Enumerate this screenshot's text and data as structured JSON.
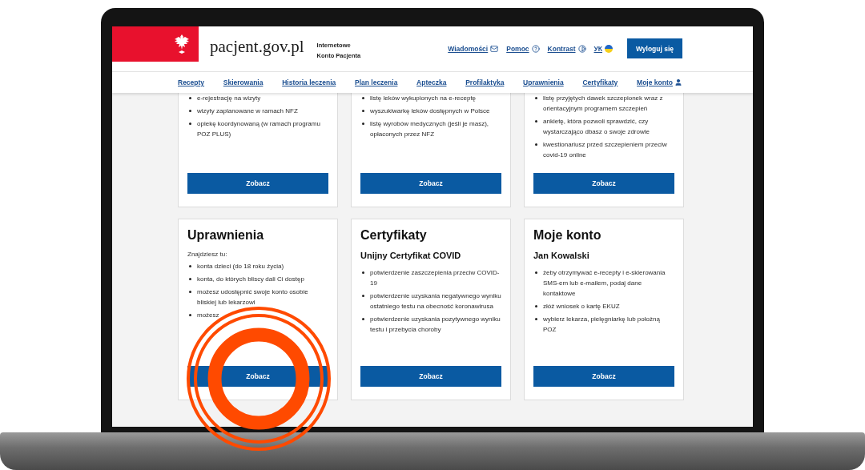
{
  "header": {
    "logo_text": "pacjent.gov.pl",
    "subtitle": [
      "Internetowe",
      "Konto Pacjenta"
    ],
    "links": [
      {
        "label": "Wiadomości",
        "kind": "mail"
      },
      {
        "label": "Pomoc",
        "kind": "help"
      },
      {
        "label": "Kontrast",
        "kind": "contrast"
      },
      {
        "label": "УК",
        "kind": "flag"
      }
    ],
    "logout_button": "Wyloguj się"
  },
  "nav": [
    {
      "label": "Recepty",
      "kind": "text"
    },
    {
      "label": "Skierowania",
      "kind": "text"
    },
    {
      "label": "Historia leczenia",
      "kind": "text"
    },
    {
      "label": "Plan leczenia",
      "kind": "text"
    },
    {
      "label": "Apteczka",
      "kind": "text"
    },
    {
      "label": "Profilaktyka",
      "kind": "text"
    },
    {
      "label": "Uprawnienia",
      "kind": "text"
    },
    {
      "label": "Certyfikaty",
      "kind": "text"
    },
    {
      "label": "Moje konto",
      "kind": "account"
    }
  ],
  "cards_top": [
    {
      "bullets": [
        "e-rejestrację na wizyty",
        "wizyty zaplanowane w ramach NFZ",
        "opiekę koordynowaną (w ramach programu POZ PLUS)"
      ],
      "button": "Zobacz"
    },
    {
      "bullets": [
        "listę leków wykupionych na e-receptę",
        "wyszukiwarkę leków dostępnych w Polsce",
        "listę wyrobów medycznych (jeśli je masz), opłaconych przez NFZ"
      ],
      "button": "Zobacz"
    },
    {
      "bullets": [
        "listę przyjętych dawek szczepionek wraz z orientacyjnym programem szczepień",
        "ankietę, która pozwoli sprawdzić, czy wystarczająco dbasz o swoje zdrowie",
        "kwestionariusz przed szczepieniem przeciw covid-19 online"
      ],
      "button": "Zobacz"
    }
  ],
  "cards_bottom": [
    {
      "title": "Uprawnienia",
      "intro": "Znajdziesz tu:",
      "bullets": [
        "konta dzieci (do 18 roku życia)",
        "konta, do których bliscy dali Ci dostęp",
        "możesz udostępnić swoje konto osobie bliskiej lub lekarzowi",
        "możesz"
      ],
      "button": "Zobacz"
    },
    {
      "title": "Certyfikaty",
      "subtitle": "Unijny Certyfikat COVID",
      "bullets": [
        "potwierdzenie zaszczepienia przeciw COVID-19",
        "potwierdzenie uzyskania negatywnego wyniku ostatniego testu na obecność koronawirusa",
        "potwierdzenie uzyskania pozytywnego wyniku testu i przebycia choroby"
      ],
      "button": "Zobacz"
    },
    {
      "title": "Moje konto",
      "subtitle": "Jan Kowalski",
      "bullets": [
        "żeby otrzymywać e-recepty i e-skierowania SMS-em lub e-mailem, podaj dane kontaktowe",
        "złóż wniosek o kartę EKUZ",
        "wybierz lekarza, pielęgniarkę lub położną POZ"
      ],
      "button": "Zobacz"
    }
  ]
}
